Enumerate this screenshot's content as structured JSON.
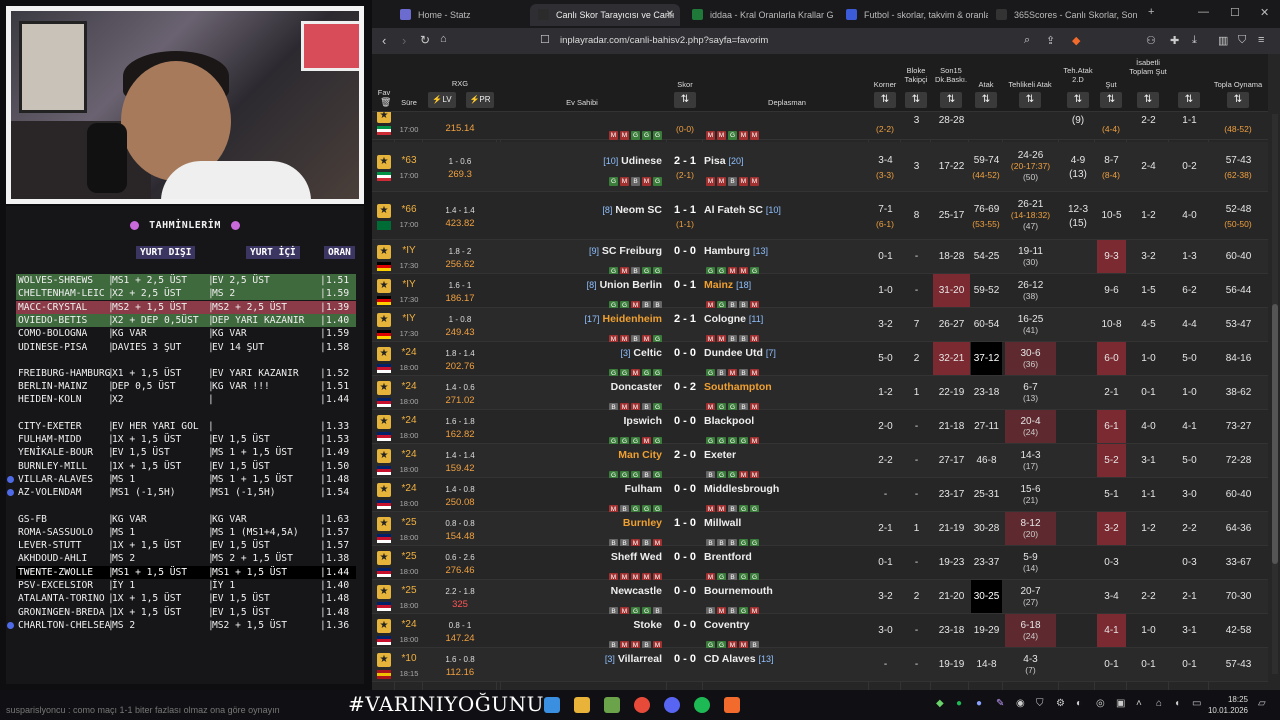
{
  "predictions": {
    "title": "TAHMİNLERİM",
    "col_away": "YURT DIŞI",
    "col_home": "YURT İÇİ",
    "col_odds": "ORAN",
    "rows": [
      {
        "match": "WOLVES-SHREWS",
        "away": "MS1 + 2,5 ÜST",
        "home": "EV 2,5 ÜST",
        "odds": "1.51",
        "hl": "green"
      },
      {
        "match": "CHELTENHAM-LEIC",
        "away": "X2 + 2,5 ÜST",
        "home": "MS 2",
        "odds": "1.59",
        "hl": "green"
      },
      {
        "match": "MACC-CRYSTAL",
        "away": "MS2 + 1,5 ÜST",
        "home": "MS2 + 2,5 ÜST",
        "odds": "1.39",
        "hl": "red"
      },
      {
        "match": "OVIEDO-BETIS",
        "away": "X2 + DEP 0,5ÜST",
        "home": "DEP YARI KAZANIR",
        "odds": "1.40",
        "hl": "green"
      },
      {
        "match": "COMO-BOLOGNA",
        "away": "KG VAR",
        "home": "KG VAR",
        "odds": "1.59",
        "hl": ""
      },
      {
        "match": "UDINESE-PISA",
        "away": "DAVIES 3 ŞUT",
        "home": "EV 14 ŞUT",
        "odds": "1.58",
        "hl": ""
      },
      {
        "match": "FREIBURG-HAMBURG",
        "away": "X1 + 1,5 ÜST",
        "home": "EV YARI KAZANIR",
        "odds": "1.52",
        "hl": ""
      },
      {
        "match": "BERLIN-MAINZ",
        "away": "DEP 0,5 ÜST",
        "home": "KG VAR !!!",
        "odds": "1.51",
        "hl": ""
      },
      {
        "match": "HEIDEN-KOLN",
        "away": "X2",
        "home": "",
        "odds": "1.44",
        "hl": ""
      },
      {
        "match": "CITY-EXETER",
        "away": "EV HER YARI GOL",
        "home": "",
        "odds": "1.33",
        "hl": ""
      },
      {
        "match": "FULHAM-MIDD",
        "away": "1X + 1,5 ÜST",
        "home": "EV 1,5 ÜST",
        "odds": "1.53",
        "hl": ""
      },
      {
        "match": "YENİKALE-BOUR",
        "away": "EV 1,5 ÜST",
        "home": "MS 1 + 1,5 ÜST",
        "odds": "1.49",
        "hl": ""
      },
      {
        "match": "BURNLEY-MILL",
        "away": "1X + 1,5 ÜST",
        "home": "EV 1,5 ÜST",
        "odds": "1.50",
        "hl": ""
      },
      {
        "match": "VILLAR-ALAVES",
        "away": "MS 1",
        "home": "MS 1 + 1,5 ÜST",
        "odds": "1.48",
        "hl": "",
        "dot": true
      },
      {
        "match": "AZ-VOLENDAM",
        "away": "MS1 (-1,5H)",
        "home": "MS1 (-1,5H)",
        "odds": "1.54",
        "hl": "",
        "dot": true
      },
      {
        "match": "GS-FB",
        "away": "KG VAR",
        "home": "KG VAR",
        "odds": "1.63",
        "hl": ""
      },
      {
        "match": "ROMA-SASSUOLO",
        "away": "MS 1",
        "home": "MS 1 (MS1+4,5A)",
        "odds": "1.57",
        "hl": ""
      },
      {
        "match": "LEVER-STUTT",
        "away": "1X + 1,5 ÜST",
        "home": "EV 1,5 ÜST",
        "odds": "1.57",
        "hl": ""
      },
      {
        "match": "AKHDOUD-AHLI",
        "away": "MS 2",
        "home": "MS 2 + 1,5 ÜST",
        "odds": "1.38",
        "hl": ""
      },
      {
        "match": "TWENTE-ZWOLLE",
        "away": "MS1 + 1,5 ÜST",
        "home": "MS1 + 1,5 ÜST",
        "odds": "1.44",
        "hl": "black"
      },
      {
        "match": "PSV-EXCELSIOR",
        "away": "İY 1",
        "home": "İY 1",
        "odds": "1.40",
        "hl": ""
      },
      {
        "match": "ATALANTA-TORINO",
        "away": "1X + 1,5 ÜST",
        "home": "EV 1,5 ÜST",
        "odds": "1.48",
        "hl": ""
      },
      {
        "match": "GRONINGEN-BREDA",
        "away": "1X + 1,5 ÜST",
        "home": "EV 1,5 ÜST",
        "odds": "1.48",
        "hl": ""
      },
      {
        "match": "CHARLTON-CHELSEA",
        "away": "MS 2",
        "home": "MS2 + 1,5 ÜST",
        "odds": "1.36",
        "hl": "",
        "dot": true
      }
    ]
  },
  "tabs": [
    {
      "label": "Home - Statz",
      "active": false,
      "color": "#6b6bd0"
    },
    {
      "label": "Canlı Skor Tarayıcısı ve Canlı",
      "active": true,
      "color": "#2b2b2b"
    },
    {
      "label": "iddaa - Kral Oranlarla Krallar Gibi",
      "active": false,
      "color": "#1f7a3a"
    },
    {
      "label": "Futbol - skorlar, takvim & oranlar",
      "active": false,
      "color": "#3b5bd9"
    },
    {
      "label": "365Scores - Canlı Skorlar, Sonuç",
      "active": false,
      "color": "#333"
    }
  ],
  "url": "inplayradar.com/canli-bahisv2.php?sayfa=favorim",
  "headers": {
    "fav": "Fav",
    "sure": "Süre",
    "rxg": "RXG",
    "lv": "LV",
    "pr": "PR",
    "home": "Ev Sahibi",
    "skor": "Skor",
    "away": "Deplasman",
    "korner": "Korner",
    "bloke": "Bloke Takipçi",
    "son15": "Son15 Dk.Baskı.",
    "atak": "Atak",
    "tatak": "Tehlikeli Atak",
    "tehatak": "Teh.Atak 2.D",
    "sut": "Şut",
    "isabet": "İsabetli Toplam Şut",
    "son15sut": "Son 15 Dakika Topl.Şut",
    "topla": "Topla Oynama"
  },
  "matches": [
    {
      "min": "",
      "ko": "17:00",
      "xg": "",
      "pr": "215.14",
      "home": "",
      "hrank": "",
      "away": "",
      "arank": "",
      "score": "",
      "ht": "(0-0)",
      "corner": "",
      "cornerht": "(2-2)",
      "bloke": "3",
      "son15": "28-28",
      "atak": "",
      "tatak": "",
      "tatakht": "(41-33)",
      "tatak2": "(13-13:26)",
      "tehatak": "(9)",
      "sut": "",
      "sutht": "(4-4)",
      "isabet": "2-2",
      "s15sut": "1-1",
      "topla": "",
      "toplaht": "(48-52)",
      "hform": "MMGGG",
      "aform": "MMGMM"
    },
    {
      "min": "*63",
      "ko": "17:00",
      "xg": "1 - 0.6",
      "pr": "269.3",
      "home": "Udinese",
      "hrank": "[10]",
      "away": "Pisa",
      "arank": "[20]",
      "score": "2 - 1",
      "ht": "(2-1)",
      "corner": "3-4",
      "cornerht": "(3-3)",
      "bloke": "3",
      "son15": "17-22",
      "atak": "59-74",
      "atakht": "(44-52)",
      "tatak": "24-26",
      "tatak2": "(20-17:37)",
      "tatak3": "(50)",
      "tehatak": "4-9",
      "tehatak2": "(13)",
      "sut": "8-7",
      "sutht": "(8-4)",
      "isabet": "2-4",
      "s15sut": "0-2",
      "topla": "57-43",
      "toplaht": "(62-38)",
      "hform": "GMBMG",
      "aform": "MMBMM"
    },
    {
      "min": "*66",
      "ko": "17:00",
      "xg": "1.4 - 1.4",
      "pr": "423.82",
      "home": "Neom SC",
      "hrank": "[8]",
      "away": "Al Fateh SC",
      "arank": "[10]",
      "score": "1 - 1",
      "ht": "(1-1)",
      "corner": "7-1",
      "cornerht": "(6-1)",
      "bloke": "8",
      "son15": "25-17",
      "atak": "76-69",
      "atakht": "(53-55)",
      "tatak": "26-21",
      "tatak2": "(14-18:32)",
      "tatak3": "(47)",
      "tehatak": "12-3",
      "tehatak2": "(15)",
      "sut": "10-5",
      "isabet": "1-2",
      "s15sut": "4-0",
      "topla": "52-48",
      "toplaht": "(50-50)",
      "hform": "",
      "aform": ""
    },
    {
      "min": "*IY",
      "ko": "17:30",
      "xg": "1.8 - 2",
      "pr": "256.62",
      "home": "SC Freiburg",
      "hrank": "[9]",
      "away": "Hamburg",
      "arank": "[13]",
      "score": "0 - 0",
      "corner": "0-1",
      "bloke": "-",
      "son15": "18-28",
      "atak": "54-25",
      "tatak": "19-11",
      "tatak3": "(30)",
      "sut": "9-3",
      "isabet": "3-2",
      "s15sut": "1-3",
      "topla": "60-40",
      "hform": "GMBGG",
      "aform": "GGMMG",
      "sutbg": "red"
    },
    {
      "min": "*IY",
      "ko": "17:30",
      "xg": "1.6 - 1",
      "pr": "186.17",
      "home": "Union Berlin",
      "hrank": "[8]",
      "away": "Mainz",
      "arank": "[18]",
      "score": "0 - 1",
      "corner": "1-0",
      "bloke": "-",
      "son15": "31-20",
      "atak": "59-52",
      "tatak": "26-12",
      "tatak3": "(38)",
      "sut": "9-6",
      "isabet": "1-5",
      "s15sut": "6-2",
      "topla": "56-44",
      "hform": "GGMBB",
      "aform": "MGBBM",
      "son15bg": "red",
      "awayorange": true
    },
    {
      "min": "*IY",
      "ko": "17:30",
      "xg": "1 - 0.8",
      "pr": "249.43",
      "home": "Heidenheim",
      "hrank": "[17]",
      "away": "Cologne",
      "arank": "[11]",
      "score": "2 - 1",
      "corner": "3-2",
      "bloke": "7",
      "son15": "26-27",
      "atak": "60-54",
      "tatak": "16-25",
      "tatak3": "(41)",
      "sut": "10-8",
      "isabet": "4-5",
      "s15sut": "4-4",
      "topla": "53-47",
      "hform": "MMBMG",
      "aform": "MMBBM",
      "homeorange": true
    },
    {
      "min": "*24",
      "ko": "18:00",
      "xg": "1.8 - 1.4",
      "pr": "202.76",
      "home": "Celtic",
      "hrank": "[3]",
      "away": "Dundee Utd",
      "arank": "[7]",
      "score": "0 - 0",
      "corner": "5-0",
      "bloke": "2",
      "son15": "32-21",
      "atak": "37-12",
      "tatak": "30-6",
      "tatak3": "(36)",
      "sut": "6-0",
      "isabet": "1-0",
      "s15sut": "5-0",
      "topla": "84-16",
      "hform": "GGMGG",
      "aform": "GBMBM",
      "son15bg": "red",
      "atakbg": "black",
      "tatakbg": "pink",
      "sutbg": "red"
    },
    {
      "min": "*24",
      "ko": "18:00",
      "xg": "1.4 - 0.6",
      "pr": "271.02",
      "home": "Doncaster",
      "hrank": "",
      "away": "Southampton",
      "arank": "",
      "score": "0 - 2",
      "corner": "1-2",
      "bloke": "1",
      "son15": "22-19",
      "atak": "23-18",
      "tatak": "6-7",
      "tatak3": "(13)",
      "sut": "2-1",
      "isabet": "0-1",
      "s15sut": "1-0",
      "topla": "38-62",
      "hform": "BMMBG",
      "aform": "MGGBM",
      "awayorange": true
    },
    {
      "min": "*24",
      "ko": "18:00",
      "xg": "1.6 - 1.8",
      "pr": "162.82",
      "home": "Ipswich",
      "hrank": "",
      "away": "Blackpool",
      "arank": "",
      "score": "0 - 0",
      "corner": "2-0",
      "bloke": "-",
      "son15": "21-18",
      "atak": "27-11",
      "tatak": "20-4",
      "tatak3": "(24)",
      "sut": "6-1",
      "isabet": "4-0",
      "s15sut": "4-1",
      "topla": "73-27",
      "hform": "GGGMG",
      "aform": "GGGGM",
      "tatakbg": "pink",
      "sutbg": "red"
    },
    {
      "min": "*24",
      "ko": "18:00",
      "xg": "1.4 - 1.4",
      "pr": "159.42",
      "home": "Man City",
      "hrank": "",
      "away": "Exeter",
      "arank": "",
      "score": "2 - 0",
      "corner": "2-2",
      "bloke": "-",
      "son15": "27-17",
      "atak": "46-8",
      "tatak": "14-3",
      "tatak3": "(17)",
      "sut": "5-2",
      "isabet": "3-1",
      "s15sut": "5-0",
      "topla": "72-28",
      "hform": "GGGBG",
      "aform": "BGGMM",
      "homeorange": true,
      "sutbg": "red"
    },
    {
      "min": "*24",
      "ko": "18:00",
      "xg": "1.4 - 0.8",
      "pr": "250.08",
      "home": "Fulham",
      "hrank": "",
      "away": "Middlesbrough",
      "arank": "",
      "score": "0 - 0",
      "corner": "-",
      "bloke": "-",
      "son15": "23-17",
      "atak": "25-31",
      "tatak": "15-6",
      "tatak3": "(21)",
      "sut": "5-1",
      "isabet": "1-1",
      "s15sut": "3-0",
      "topla": "60-40",
      "hform": "MBGGG",
      "aform": "MMBGG"
    },
    {
      "min": "*25",
      "ko": "18:00",
      "xg": "0.8 - 0.8",
      "pr": "154.48",
      "home": "Burnley",
      "hrank": "",
      "away": "Millwall",
      "arank": "",
      "score": "1 - 0",
      "corner": "2-1",
      "bloke": "1",
      "son15": "21-19",
      "atak": "30-28",
      "tatak": "8-12",
      "tatak3": "(20)",
      "sut": "3-2",
      "isabet": "1-2",
      "s15sut": "2-2",
      "topla": "64-36",
      "hform": "BBMBM",
      "aform": "BBBGG",
      "homeorange": true,
      "tatakbg": "pink",
      "sutbg": "red"
    },
    {
      "min": "*25",
      "ko": "18:00",
      "xg": "0.6 - 2.6",
      "pr": "276.46",
      "home": "Sheff Wed",
      "hrank": "",
      "away": "Brentford",
      "arank": "",
      "score": "0 - 0",
      "corner": "0-1",
      "bloke": "-",
      "son15": "19-23",
      "atak": "23-37",
      "tatak": "5-9",
      "tatak3": "(14)",
      "sut": "0-3",
      "isabet": "",
      "s15sut": "0-3",
      "topla": "33-67",
      "hform": "MMMMM",
      "aform": "MGBGG"
    },
    {
      "min": "*25",
      "ko": "18:00",
      "xg": "2.2 - 1.8",
      "pr": "325",
      "home": "Newcastle",
      "hrank": "",
      "away": "Bournemouth",
      "arank": "",
      "score": "0 - 0",
      "corner": "3-2",
      "bloke": "2",
      "son15": "21-20",
      "atak": "30-25",
      "tatak": "20-7",
      "tatak3": "(27)",
      "sut": "3-4",
      "isabet": "2-2",
      "s15sut": "2-1",
      "topla": "70-30",
      "hform": "BMGGB",
      "aform": "BMBGM",
      "prred": true,
      "atakbg": "black"
    },
    {
      "min": "*24",
      "ko": "18:00",
      "xg": "0.8 - 1",
      "pr": "147.24",
      "home": "Stoke",
      "hrank": "",
      "away": "Coventry",
      "arank": "",
      "score": "0 - 0",
      "corner": "3-0",
      "bloke": "-",
      "son15": "23-18",
      "atak": "19-29",
      "tatak": "6-18",
      "tatak3": "(24)",
      "sut": "4-1",
      "isabet": "1-0",
      "s15sut": "3-1",
      "topla": "42-58",
      "hform": "BMMBM",
      "aform": "GGMMB",
      "tatakbg": "pink",
      "sutbg": "red"
    },
    {
      "min": "*10",
      "ko": "18:15",
      "xg": "1.6 - 0.8",
      "pr": "112.16",
      "home": "Villarreal",
      "hrank": "[3]",
      "away": "CD Alaves",
      "arank": "[13]",
      "score": "0 - 0",
      "corner": "-",
      "bloke": "-",
      "son15": "19-19",
      "atak": "14-8",
      "tatak": "4-3",
      "tatak3": "(7)",
      "sut": "0-1",
      "isabet": "0-1",
      "s15sut": "0-1",
      "topla": "57-43",
      "hform": "",
      "aform": ""
    }
  ],
  "chat": "susparislyoncu : como maçı 1-1 biter fazlası olmaz ona göre oynayın",
  "hashtag": "#VARINIYOĞUNU",
  "clock": {
    "time": "18:25",
    "date": "10.01.2026"
  }
}
